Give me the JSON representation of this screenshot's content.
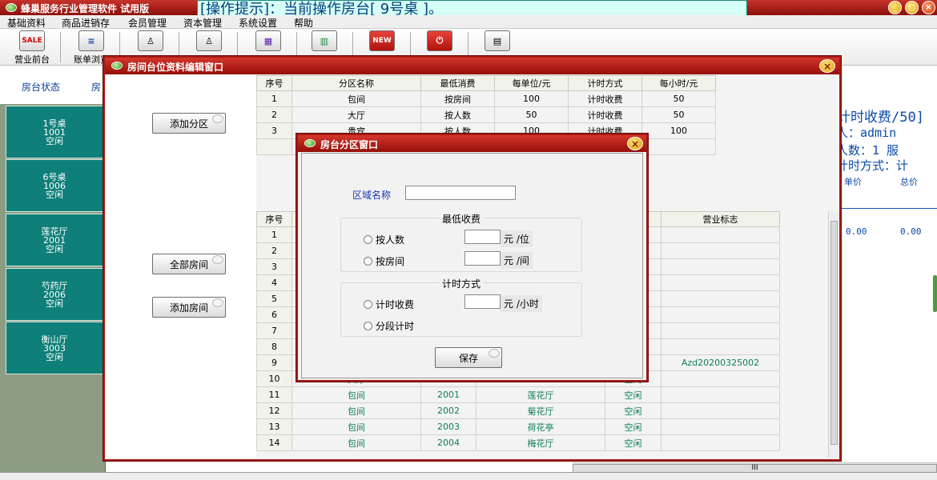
{
  "app": {
    "title": "蜂巢服务行业管理软件 试用版",
    "op_hint": "[操作提示]：当前操作房台[ 9号桌 ]。",
    "window_buttons": [
      "_",
      "□",
      "×"
    ],
    "icons": {
      "app": "app-green-icon"
    }
  },
  "menu": [
    "基础资料",
    "商品进销存",
    "会员管理",
    "资本管理",
    "系统设置",
    "帮助"
  ],
  "toolbar": {
    "buttons": [
      {
        "label": "营业前台",
        "icon_text": "SALE"
      },
      {
        "label": "账单浏览",
        "icon_text": "≡"
      },
      {
        "label": "",
        "icon_text": "♙"
      },
      {
        "label": "",
        "icon_text": "♙"
      },
      {
        "label": "",
        "icon_text": "▦"
      },
      {
        "label": "",
        "icon_text": "▥"
      },
      {
        "label": "",
        "icon_text": "NEW"
      },
      {
        "label": "",
        "icon_text": "⏻"
      },
      {
        "label": "",
        "icon_text": "▤"
      }
    ]
  },
  "background": {
    "tabs": [
      "房台状态",
      "房"
    ],
    "rooms": [
      {
        "name": "1号桌",
        "code": "1001",
        "status": "空闲"
      },
      {
        "name": "6号桌",
        "code": "1006",
        "status": "空闲"
      },
      {
        "name": "莲花厅",
        "code": "2001",
        "status": "空闲"
      },
      {
        "name": "芍药厅",
        "code": "2006",
        "status": "空闲"
      },
      {
        "name": "衡山厅",
        "code": "3003",
        "status": "空闲"
      }
    ],
    "right_panel": {
      "header": "计时收费/50]",
      "operator": "人：admin",
      "count": "人数：1   服",
      "method": "计时方式：计",
      "col_price": "单价",
      "col_total": "总价",
      "price_val": "0.00",
      "total_val": "0.00",
      "bracket": "C",
      "bottom_scroll": "III"
    }
  },
  "dialog1": {
    "title": "房间台位资料编辑窗口",
    "buttons": {
      "add_zone": "添加分区",
      "all_rooms": "全部房间",
      "add_room": "添加房间"
    },
    "zone_table": {
      "headers": [
        "序号",
        "分区名称",
        "最低消费",
        "每单位/元",
        "计时方式",
        "每小时/元"
      ],
      "rows": [
        [
          "1",
          "包间",
          "按房间",
          "100",
          "计时收费",
          "50"
        ],
        [
          "2",
          "大厅",
          "按人数",
          "50",
          "计时收费",
          "50"
        ],
        [
          "3",
          "贵宾",
          "按人数",
          "100",
          "计时收费",
          "100"
        ],
        [
          "",
          "",
          "",
          "",
          "",
          ""
        ]
      ]
    },
    "room_table": {
      "headers": [
        "序号",
        "",
        "",
        "",
        "态",
        "营业标志"
      ],
      "rows": [
        [
          "1",
          "",
          "",
          "",
          "",
          ""
        ],
        [
          "2",
          "",
          "",
          "",
          "",
          ""
        ],
        [
          "3",
          "",
          "",
          "",
          "",
          ""
        ],
        [
          "4",
          "",
          "",
          "",
          "",
          ""
        ],
        [
          "5",
          "",
          "",
          "",
          "",
          ""
        ],
        [
          "6",
          "",
          "",
          "",
          "",
          ""
        ],
        [
          "7",
          "",
          "",
          "",
          "",
          ""
        ],
        [
          "8",
          "",
          "",
          "",
          "",
          ""
        ],
        [
          "9",
          "",
          "",
          "",
          "",
          "Azd20200325002"
        ],
        [
          "10",
          "大厅",
          "",
          "",
          "空闲",
          ""
        ],
        [
          "11",
          "包间",
          "2001",
          "莲花厅",
          "空闲",
          ""
        ],
        [
          "12",
          "包间",
          "2002",
          "菊花厅",
          "空闲",
          ""
        ],
        [
          "13",
          "包间",
          "2003",
          "荷花亭",
          "空闲",
          ""
        ],
        [
          "14",
          "包间",
          "2004",
          "梅花厅",
          "空闲",
          ""
        ]
      ]
    }
  },
  "dialog2": {
    "title": "房台分区窗口",
    "area_label": "区域名称",
    "area_value": "",
    "min_group": {
      "title": "最低收费",
      "by_person": "按人数",
      "by_person_unit": "元 /位",
      "by_room": "按房间",
      "by_room_unit": "元 /间"
    },
    "time_group": {
      "title": "计时方式",
      "timed": "计时收费",
      "timed_unit": "元 /小时",
      "segment": "分段计时"
    },
    "save": "保存"
  }
}
